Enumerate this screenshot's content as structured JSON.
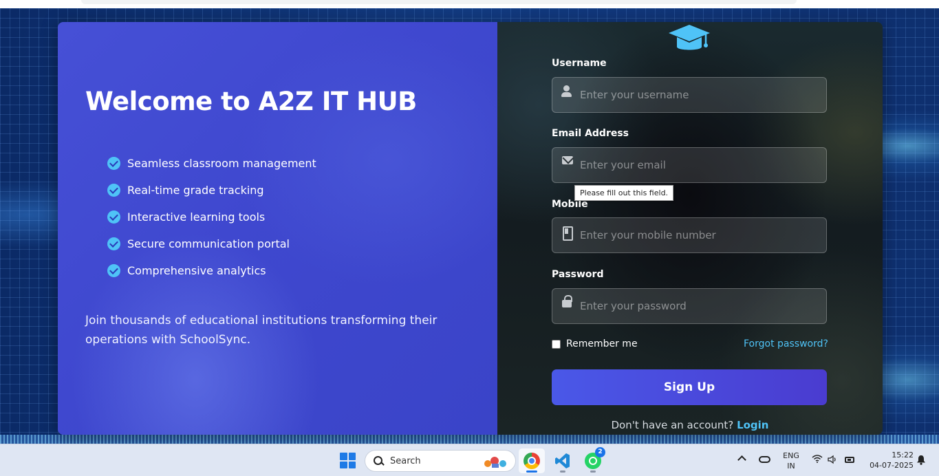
{
  "hero": {
    "title": "Welcome to A2Z IT HUB",
    "features": [
      "Seamless classroom management",
      "Real-time grade tracking",
      "Interactive learning tools",
      "Secure communication portal",
      "Comprehensive analytics"
    ],
    "tagline": "Join thousands of educational institutions transforming their operations with SchoolSync."
  },
  "form": {
    "username": {
      "label": "Username",
      "placeholder": "Enter your username",
      "value": ""
    },
    "email": {
      "label": "Email Address",
      "placeholder": "Enter your email",
      "value": ""
    },
    "mobile": {
      "label": "Mobile",
      "placeholder": "Enter your mobile number",
      "value": ""
    },
    "password": {
      "label": "Password",
      "placeholder": "Enter your password",
      "value": ""
    },
    "validation_tooltip": "Please fill out this field.",
    "remember_label": "Remember me",
    "remember_checked": false,
    "forgot_label": "Forgot password?",
    "submit_label": "Sign Up",
    "account_prompt": "Don't have an account?",
    "login_label": "Login"
  },
  "colors": {
    "accent": "#4fc3f7",
    "left_panel": "#4650d6",
    "button": "#4a58e8"
  },
  "taskbar": {
    "search_placeholder": "Search",
    "apps": [
      {
        "name": "chrome-icon",
        "active": true
      },
      {
        "name": "vscode-icon",
        "active": false
      },
      {
        "name": "whatsapp-icon",
        "active": false,
        "badge": "2"
      }
    ],
    "lang_line1": "ENG",
    "lang_line2": "IN",
    "time": "15:22",
    "date": "04-07-2025"
  }
}
